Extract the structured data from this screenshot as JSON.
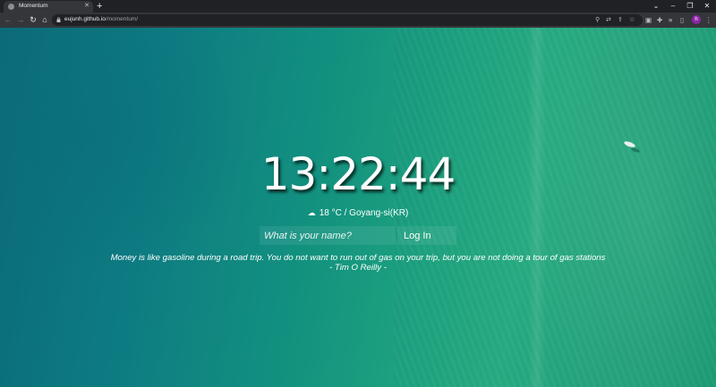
{
  "browser": {
    "tab_title": "Momentum",
    "new_tab": "+",
    "tab_close": "✕",
    "url_host": "eujunh.github.io",
    "url_path": "/momentum/",
    "avatar_initial": "h",
    "avatar_color": "#8e24aa"
  },
  "app": {
    "clock": "13:22:44",
    "weather": "18 °C / Goyang-si(KR)",
    "weather_icon": "cloud-icon",
    "name_placeholder": "What is your name?",
    "login_label": "Log In",
    "quote_text": "Money is like gasoline during a road trip. You do not want to run out of gas on your trip, but you are not doing a tour of gas stations",
    "quote_author": "- Tim O Reilly -"
  }
}
